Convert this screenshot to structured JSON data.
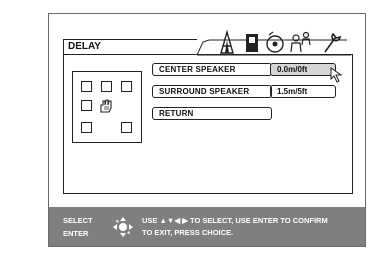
{
  "dialog": {
    "title": "DELAY"
  },
  "tabs": {
    "icons": [
      "speaker-setup-icon",
      "speaker-level-icon",
      "disc-icon",
      "people-icon",
      "wrench-icon"
    ]
  },
  "menu": {
    "items": [
      {
        "label": "CENTER SPEAKER",
        "value": "0.0m/0ft",
        "selected": true
      },
      {
        "label": "SURROUND SPEAKER",
        "value": "1.5m/5ft",
        "selected": false
      },
      {
        "label": "RETURN"
      }
    ]
  },
  "footer": {
    "select_label": "SELECT",
    "enter_label": "ENTER",
    "help_line1": "USE ▲▼◀ ▶ TO SELECT, USE ENTER TO CONFIRM",
    "help_line2": "TO EXIT, PRESS CHOICE."
  },
  "colors": {
    "footer_bg": "#7f7f7f",
    "selected_bg": "#d6d6d6",
    "border": "#222222"
  }
}
